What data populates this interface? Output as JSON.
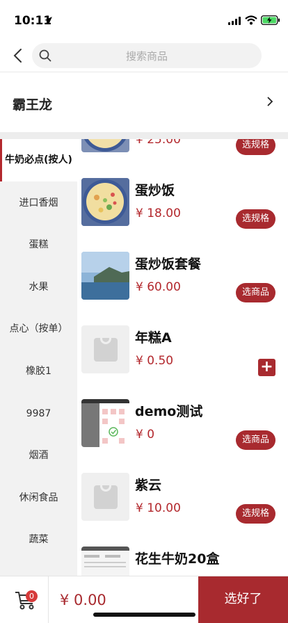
{
  "status_bar": {
    "time": "10:11"
  },
  "search": {
    "placeholder": "搜索商品"
  },
  "store": {
    "name": "霸王龙"
  },
  "categories": [
    {
      "label": "牛奶必点(按人)",
      "active": true
    },
    {
      "label": "进口香烟"
    },
    {
      "label": "蛋糕"
    },
    {
      "label": "水果"
    },
    {
      "label": "点心（按单）"
    },
    {
      "label": "橡胶1"
    },
    {
      "label": "9987"
    },
    {
      "label": "烟酒"
    },
    {
      "label": "休闲食品"
    },
    {
      "label": "蔬菜"
    }
  ],
  "products": [
    {
      "name": "",
      "price": "¥ 25.00",
      "action": "选规格"
    },
    {
      "name": "蛋炒饭",
      "price": "¥ 18.00",
      "action": "选规格"
    },
    {
      "name": "蛋炒饭套餐",
      "price": "¥ 60.00",
      "action": "选商品"
    },
    {
      "name": "年糕A",
      "price": "¥ 0.50",
      "action": "+"
    },
    {
      "name": "demo测试",
      "price": "¥ 0",
      "action": "选商品"
    },
    {
      "name": "紫云",
      "price": "¥ 10.00",
      "action": "选规格"
    },
    {
      "name": "花生牛奶20盒",
      "price": "",
      "action": ""
    }
  ],
  "cart": {
    "count": "0",
    "total": "¥ 0.00",
    "submit_label": "选好了"
  },
  "colors": {
    "accent": "#a82a2f",
    "sidebar_bg": "#f2f2f2"
  }
}
